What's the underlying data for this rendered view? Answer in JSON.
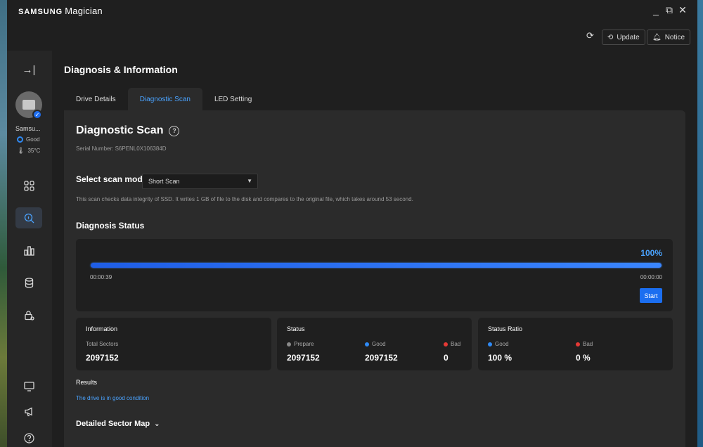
{
  "app": {
    "brand_bold": "SAMSUNG",
    "brand_name": "Magician"
  },
  "window_controls": {
    "minimize": "_",
    "restore": "⧉",
    "close": "✕"
  },
  "topbar": {
    "refresh_icon": "refresh-icon",
    "update_label": "Update",
    "notice_label": "Notice"
  },
  "sidebar": {
    "collapse_icon": "→|",
    "drive": {
      "name": "Samsu...",
      "health": "Good",
      "temperature": "35°C"
    },
    "nav": [
      {
        "name": "dashboard",
        "icon": "▦"
      },
      {
        "name": "diagnosis",
        "icon": "🔍",
        "active": true
      },
      {
        "name": "benchmark",
        "icon": "📊"
      },
      {
        "name": "data-management",
        "icon": "🗄"
      },
      {
        "name": "security",
        "icon": "🔒"
      }
    ],
    "bottom": [
      {
        "name": "display",
        "icon": "🖥"
      },
      {
        "name": "announcements",
        "icon": "📢"
      },
      {
        "name": "help",
        "icon": "?"
      }
    ]
  },
  "page": {
    "title": "Diagnosis & Information"
  },
  "tabs": [
    {
      "label": "Drive Details"
    },
    {
      "label": "Diagnostic Scan",
      "active": true
    },
    {
      "label": "LED Setting"
    }
  ],
  "scan": {
    "title": "Diagnostic Scan",
    "serial": "Serial Number: S6PENL0X106384D",
    "mode_label": "Select scan mode",
    "mode_value": "Short Scan",
    "mode_description": "This scan checks data integrity of SSD. It writes 1 GB of file to the disk and compares to the original file, which takes around 53 second.",
    "status_title": "Diagnosis Status",
    "progress_label": "100%",
    "progress": 1.0,
    "elapsed": "00:00:39",
    "remaining": "00:00:00",
    "start_label": "Start"
  },
  "info": {
    "heading": "Information",
    "sub": "Total Sectors",
    "value": "2097152"
  },
  "status": {
    "heading": "Status",
    "items": [
      {
        "label": "Prepare",
        "value": "2097152",
        "color": "#8a8a8a"
      },
      {
        "label": "Good",
        "value": "2097152",
        "color": "#2f8af5"
      },
      {
        "label": "Bad",
        "value": "0",
        "color": "#e53935"
      }
    ]
  },
  "ratio": {
    "heading": "Status Ratio",
    "items": [
      {
        "label": "Good",
        "value": "100 %",
        "color": "#2f8af5"
      },
      {
        "label": "Bad",
        "value": "0 %",
        "color": "#e53935"
      }
    ]
  },
  "results": {
    "label": "Results",
    "text": "The drive is in good condition"
  },
  "sector_map": {
    "label": "Detailed Sector Map",
    "caret": "⌄"
  }
}
